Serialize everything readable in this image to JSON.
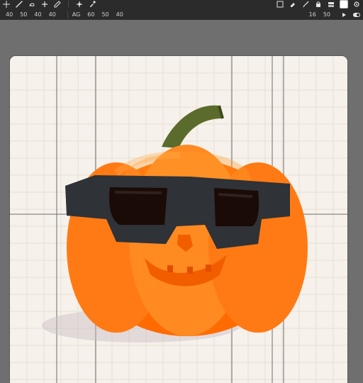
{
  "app": {
    "name": "",
    "accent": "#ff7a1a"
  },
  "toolbar": {
    "top_left_icons": [
      "move-icon",
      "brush-icon",
      "lasso-icon",
      "add-icon",
      "pen-icon",
      "sparkle-icon",
      "eyedropper-icon"
    ],
    "row2_left_numbers": [
      "40",
      "50",
      "40",
      "40"
    ],
    "row2_middle_numbers": [
      "60",
      "50",
      "40"
    ],
    "row2_right_items": [
      "16",
      "50"
    ],
    "top_middle_text": "AG",
    "colors": {
      "toolbar_bg": "#2b2b2b",
      "toolbar_text": "#e6e6e6",
      "canvas_bg": "#f6f1ea",
      "workspace_bg": "#6f6f6f"
    }
  },
  "canvas": {
    "subject": "pumpkin-with-sunglasses",
    "grid": "on",
    "colors": {
      "pumpkin": "#ff6b00",
      "pumpkin_highlight": "#ff9a2a",
      "glasses_frame": "#2f3236",
      "stem": "#5a6b2b"
    }
  }
}
